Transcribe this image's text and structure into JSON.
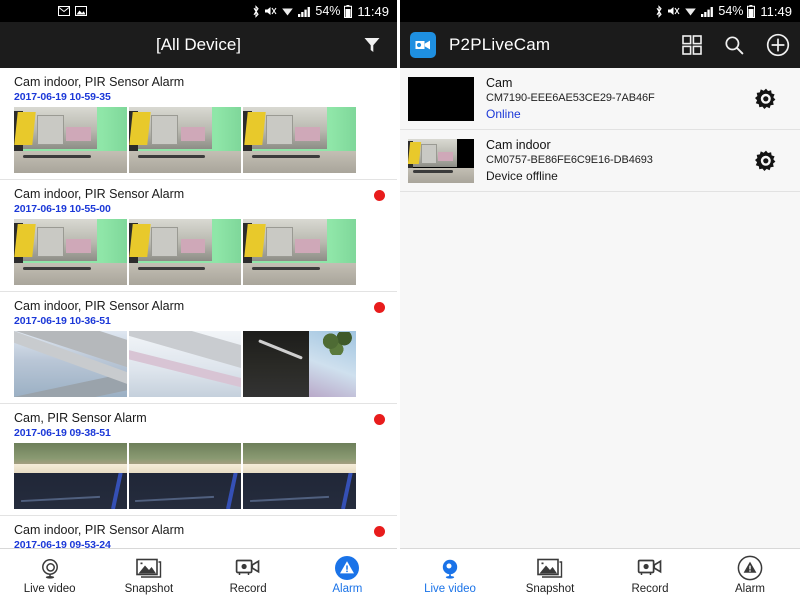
{
  "statusbar": {
    "left_icons": [
      "gmail-icon",
      "screenshot-icon"
    ],
    "right_icons": [
      "bluetooth-icon",
      "vibrate-mute-icon",
      "wifi-icon",
      "cellular-signal-icon"
    ],
    "battery_percent": "54%",
    "time": "11:49"
  },
  "left_panel": {
    "appbar": {
      "title": "[All Device]",
      "filter_icon": "filter-funnel-icon"
    },
    "alarms": [
      {
        "title": "Cam indoor, PIR Sensor Alarm",
        "time": "2017-06-19 10-59-35",
        "unread": false,
        "scene": "indoor"
      },
      {
        "title": "Cam indoor, PIR Sensor Alarm",
        "time": "2017-06-19 10-55-00",
        "unread": true,
        "scene": "indoor"
      },
      {
        "title": "Cam indoor, PIR Sensor Alarm",
        "time": "2017-06-19 10-36-51",
        "unread": true,
        "scene": "roof"
      },
      {
        "title": "Cam, PIR Sensor Alarm",
        "time": "2017-06-19 09-38-51",
        "unread": true,
        "scene": "road"
      },
      {
        "title": "Cam indoor, PIR Sensor Alarm",
        "time": "2017-06-19 09-53-24",
        "unread": true,
        "scene": "none"
      }
    ],
    "bottomnav": {
      "active": "Alarm",
      "items": [
        {
          "label": "Live video",
          "icon": "live-video-icon"
        },
        {
          "label": "Snapshot",
          "icon": "snapshot-icon"
        },
        {
          "label": "Record",
          "icon": "record-camcorder-icon"
        },
        {
          "label": "Alarm",
          "icon": "alarm-triangle-icon"
        }
      ]
    }
  },
  "right_panel": {
    "appbar": {
      "title": "P2PLiveCam",
      "logo_icon": "camcorder-app-logo-icon",
      "actions": [
        "grid-view-icon",
        "search-icon",
        "add-plus-circle-icon"
      ]
    },
    "devices": [
      {
        "name": "Cam",
        "id": "CM7190-EEE6AE53CE29-7AB46F",
        "status": "Online",
        "status_color": "#1b38d8",
        "thumb": "black",
        "settings_icon": "gear-icon"
      },
      {
        "name": "Cam indoor",
        "id": "CM0757-BE86FE6C9E16-DB4693",
        "status": "Device offline",
        "status_color": "#1a1a1a",
        "thumb": "indoor",
        "settings_icon": "gear-icon"
      }
    ],
    "bottomnav": {
      "active": "Live video",
      "items": [
        {
          "label": "Live video",
          "icon": "live-video-icon"
        },
        {
          "label": "Snapshot",
          "icon": "snapshot-icon"
        },
        {
          "label": "Record",
          "icon": "record-camcorder-icon"
        },
        {
          "label": "Alarm",
          "icon": "alarm-triangle-icon"
        }
      ]
    }
  },
  "colors": {
    "accent_blue": "#1a73e8",
    "link_blue": "#1b38d8",
    "alarm_red": "#e81c1c",
    "appbar_dark": "#1b1b1b",
    "logo_blue": "#1e8fe0"
  }
}
